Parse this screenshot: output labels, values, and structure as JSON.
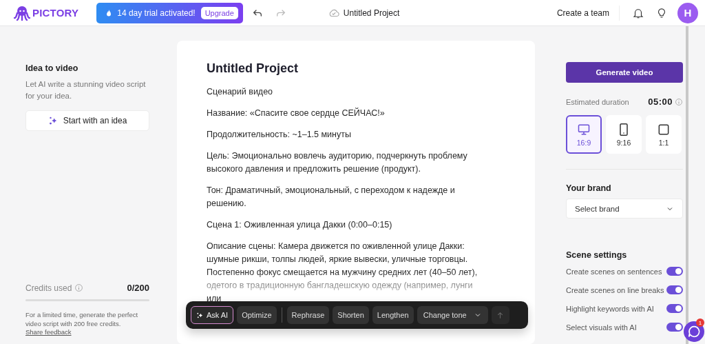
{
  "header": {
    "logo": "PICTORY",
    "trial": {
      "text": "14 day trial activated!",
      "button": "Upgrade"
    },
    "project_title": "Untitled Project",
    "team_link": "Create a team",
    "avatar": "H"
  },
  "idea_panel": {
    "title": "Idea to video",
    "description": "Let AI write a stunning video script for your idea.",
    "button": "Start with an idea",
    "credits": {
      "label": "Credits used",
      "value": "0/200",
      "level": 0
    },
    "note": "For a limited time, generate the perfect video script with 200 free credits.",
    "feedback_link": "Share feedback"
  },
  "editor": {
    "title": "Untitled Project",
    "paragraphs": [
      "Сценарий видео",
      "Название: «Спасите свое сердце СЕЙЧАС!»",
      "Продолжительность: ~1–1.5 минуты",
      "Цель: Эмоционально вовлечь аудиторию, подчеркнуть проблему высокого давления и предложить решение (продукт).",
      "Тон: Драматичный, эмоциональный, с переходом к надежде и решению.",
      "Сцена 1: Оживленная улица Дакки (0:00–0:15)",
      "Описание сцены: Камера движется по оживленной улице Дакки: шумные рикши, толпы людей, яркие вывески, уличные торговцы. Постепенно фокус смещается на мужчину средних лет (40–50 лет), одетого в традиционную бангладешскую одежду (например, лунги или"
    ],
    "toolbar": [
      {
        "label": "Ask AI",
        "kind": "ai"
      },
      {
        "label": "Optimize",
        "kind": "plain"
      },
      {
        "kind": "divider"
      },
      {
        "label": "Rephrase",
        "kind": "plain"
      },
      {
        "label": "Shorten",
        "kind": "plain"
      },
      {
        "label": "Lengthen",
        "kind": "plain"
      },
      {
        "label": "Change tone",
        "kind": "dropdown"
      },
      {
        "kind": "send"
      }
    ]
  },
  "settings": {
    "generate_button": "Generate video",
    "duration": {
      "label": "Estimated duration",
      "value": "05:00"
    },
    "aspect_ratios": [
      {
        "label": "16:9",
        "kind": "landscape",
        "selected": true
      },
      {
        "label": "9:16",
        "kind": "portrait",
        "selected": false
      },
      {
        "label": "1:1",
        "kind": "square",
        "selected": false
      }
    ],
    "brand": {
      "title": "Your brand",
      "placeholder": "Select brand"
    },
    "scene_settings": {
      "title": "Scene settings",
      "toggles": [
        {
          "label": "Create scenes on sentences",
          "on": true
        },
        {
          "label": "Create scenes on line breaks",
          "on": true
        },
        {
          "label": "Highlight keywords with AI",
          "on": true
        },
        {
          "label": "Select visuals with AI",
          "on": true
        }
      ]
    }
  },
  "chat": {
    "badge": "1"
  }
}
